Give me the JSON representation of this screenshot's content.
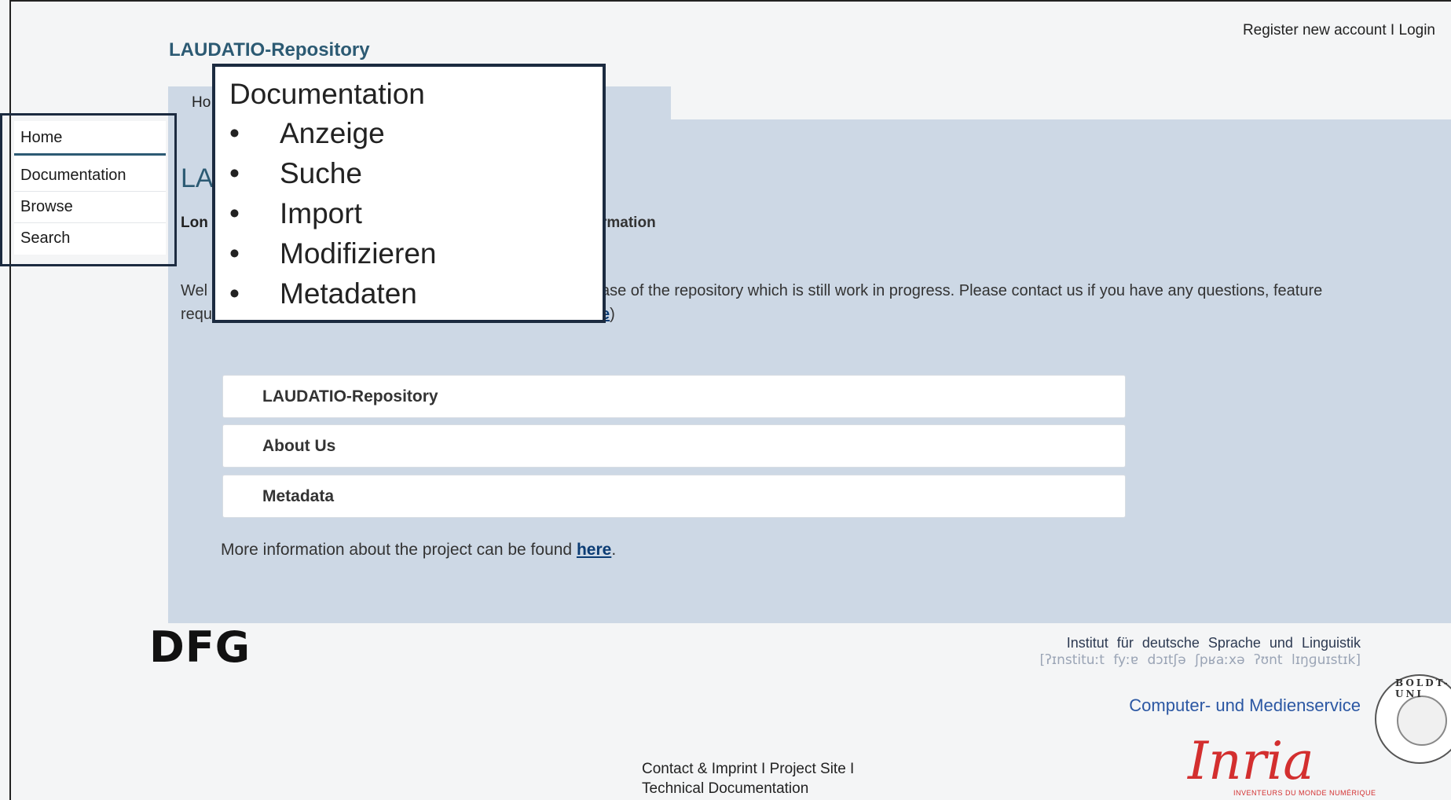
{
  "header": {
    "register_label": "Register new account",
    "separator": " I ",
    "login_label": "Login",
    "site_title": "LAUDATIO-Repository"
  },
  "breadcrumb_partial": "Ho",
  "page_heading_partial": "LA",
  "subtitle": {
    "left": "Lon",
    "right": "rmation"
  },
  "welcome": {
    "left_line1": "Wel",
    "left_line2": "requ",
    "right_line1": "ase of the repository which is still work in progress. Please contact us if you have any questions, feature",
    "right_line2_link": "e",
    "right_line2_after": ")"
  },
  "sidebar": {
    "items": [
      {
        "label": "Home"
      },
      {
        "label": "Documentation"
      },
      {
        "label": "Browse"
      },
      {
        "label": "Search"
      }
    ]
  },
  "callout": {
    "title": "Documentation",
    "bullet": "•",
    "items": [
      "Anzeige",
      "Suche",
      "Import",
      "Modifizieren",
      "Metadaten"
    ]
  },
  "accordion": [
    {
      "label": "LAUDATIO-Repository"
    },
    {
      "label": "About Us"
    },
    {
      "label": "Metadata"
    }
  ],
  "more_info": {
    "before": "More information about the project can be found ",
    "link": "here",
    "after": "."
  },
  "logos": {
    "dfg": "DFG",
    "institute": "Institut für deutsche Sprache und Linguistik",
    "ipa": "[ʔɪnstituːt fyːɐ dɔɪtʃə ʃpʁaːxə ʔʊnt lɪŋɡuɪstɪk]",
    "cms": "Computer- und Medienservice",
    "seal_text": "BOLDT-UNI",
    "inria": "Inria",
    "inria_tagline": "INVENTEURS DU MONDE NUMÉRIQUE"
  },
  "footer": {
    "contact": "Contact & Imprint",
    "separator": " I ",
    "project_site": "Project Site",
    "trailing_sep": " I",
    "tech_doc": "Technical Documentation"
  }
}
